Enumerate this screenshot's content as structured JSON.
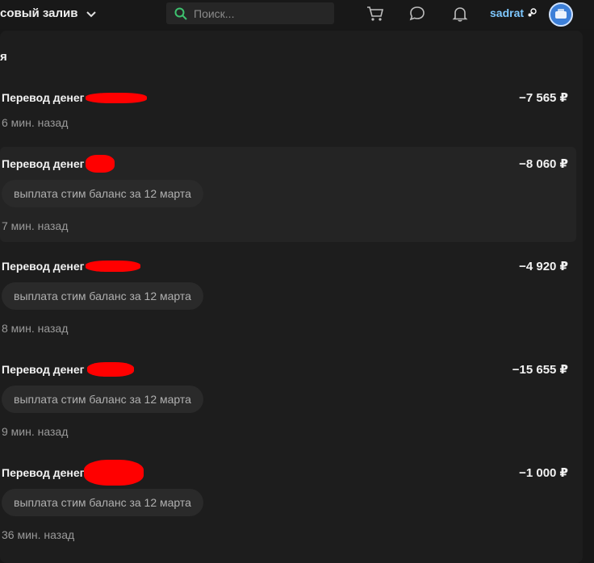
{
  "header": {
    "brand": "совый залив",
    "search_placeholder": "Поиск...",
    "username": "sadrat"
  },
  "panel": {
    "title": "я"
  },
  "transactions": [
    {
      "title": "Перевод денег",
      "amount": "−7 565 ₽",
      "note": "",
      "time": "6 мин. назад"
    },
    {
      "title": "Перевод денег",
      "amount": "−8 060 ₽",
      "note": "выплата стим баланс за 12 марта",
      "time": "7 мин. назад"
    },
    {
      "title": "Перевод денег",
      "amount": "−4 920 ₽",
      "note": "выплата стим баланс за 12 марта",
      "time": "8 мин. назад"
    },
    {
      "title": "Перевод денег",
      "amount": "−15 655 ₽",
      "note": "выплата стим баланс за 12 марта",
      "time": "9 мин. назад"
    },
    {
      "title": "Перевод денег",
      "amount": "−1 000 ₽",
      "note": "выплата стим баланс за 12 марта",
      "time": "36 мин. назад"
    }
  ],
  "colors": {
    "accent_username": "#7ec8ff",
    "search_icon": "#3ec26f",
    "redaction": "#ff0000"
  }
}
